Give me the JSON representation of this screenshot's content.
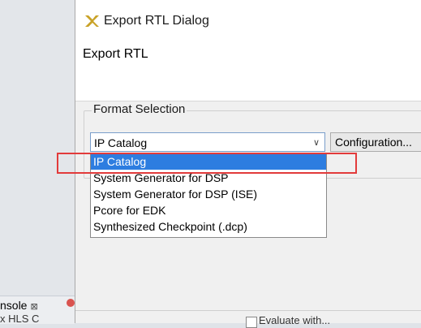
{
  "background": {
    "console_tab_label": "nsole",
    "console_tab_close": "⊠",
    "second_line_text": "x HLS C"
  },
  "dialog": {
    "window_title": "Export RTL Dialog",
    "header_title": "Export RTL",
    "group_label": "Format Selection",
    "format_select": {
      "selected": "IP Catalog",
      "options": [
        "IP Catalog",
        "System Generator for DSP",
        "System Generator for DSP (ISE)",
        "Pcore for EDK",
        "Synthesized Checkpoint (.dcp)"
      ]
    },
    "configuration_button_label": "Configuration...",
    "footer_text": "Evaluate with..."
  },
  "colors": {
    "selection": "#2d7de0",
    "annotation_red": "#e23b3b",
    "dialog_bg": "#f0f0f0"
  }
}
